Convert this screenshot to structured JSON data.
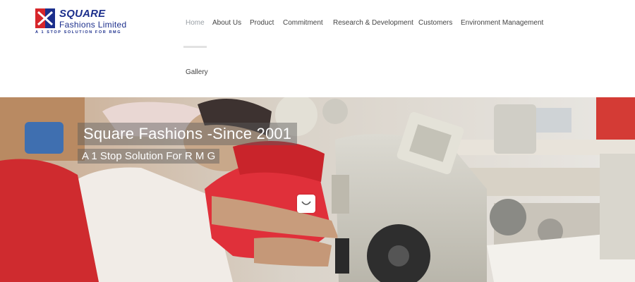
{
  "brand": {
    "name": "SQUARE",
    "subtitle": "Fashions Limited",
    "tagline": "A 1 STOP SOLUTION FOR RMG",
    "logo_icon": "square-logo-icon",
    "colors": {
      "blue": "#1c2f8c",
      "red": "#d7262b"
    }
  },
  "nav": {
    "items": [
      {
        "label": "Home",
        "active": true
      },
      {
        "label": "About Us"
      },
      {
        "label": "Product"
      },
      {
        "label": "Commitment"
      },
      {
        "label": "Research & Development"
      },
      {
        "label": "Customers"
      },
      {
        "label": "Environment Management"
      },
      {
        "label": "Gallery"
      }
    ]
  },
  "hero": {
    "title": "Square Fashions -Since 2001",
    "subtitle": "A 1 Stop Solution For R M G",
    "scroll_icon": "chevron-down-icon"
  }
}
